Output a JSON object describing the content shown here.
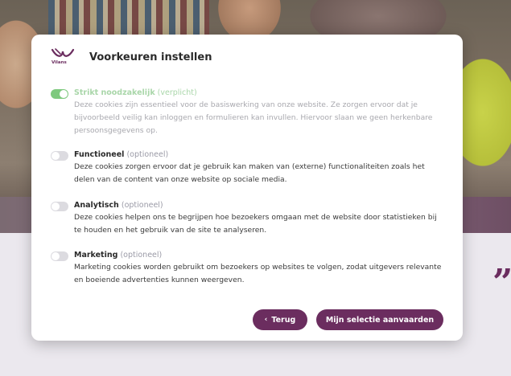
{
  "modal": {
    "title": "Voorkeuren instellen",
    "logo_text": "Vilans"
  },
  "options": [
    {
      "name": "Strikt noodzakelijk",
      "tag": "(verplicht)",
      "enabled": true,
      "locked": true,
      "description": "Deze cookies zijn essentieel voor de basiswerking van onze website. Ze zorgen ervoor dat je bijvoorbeeld veilig kan inloggen en formulieren kan invullen. Hiervoor slaan we geen herkenbare persoonsgegevens op."
    },
    {
      "name": "Functioneel",
      "tag": "(optioneel)",
      "enabled": false,
      "locked": false,
      "description": "Deze cookies zorgen ervoor dat je gebruik kan maken van (externe) functionaliteiten zoals het delen van de content van onze website op sociale media."
    },
    {
      "name": "Analytisch",
      "tag": "(optioneel)",
      "enabled": false,
      "locked": false,
      "description": "Deze cookies helpen ons te begrijpen hoe bezoekers omgaan met de website door statistieken bij te houden en het gebruik van de site te analyseren."
    },
    {
      "name": "Marketing",
      "tag": "(optioneel)",
      "enabled": false,
      "locked": false,
      "description": "Marketing cookies worden gebruikt om bezoekers op websites te volgen, zodat uitgevers relevante en boeiende advertenties kunnen weergeven."
    }
  ],
  "buttons": {
    "back_icon": "chevron-left-icon",
    "back_label": "Terug",
    "accept_label": "Mijn selectie aanvaarden"
  },
  "background": {
    "quote_mark": "”"
  },
  "colors": {
    "brand": "#6b2d5f",
    "toggle_on": "#7ec97e",
    "toggle_off": "#dcdbe0"
  }
}
